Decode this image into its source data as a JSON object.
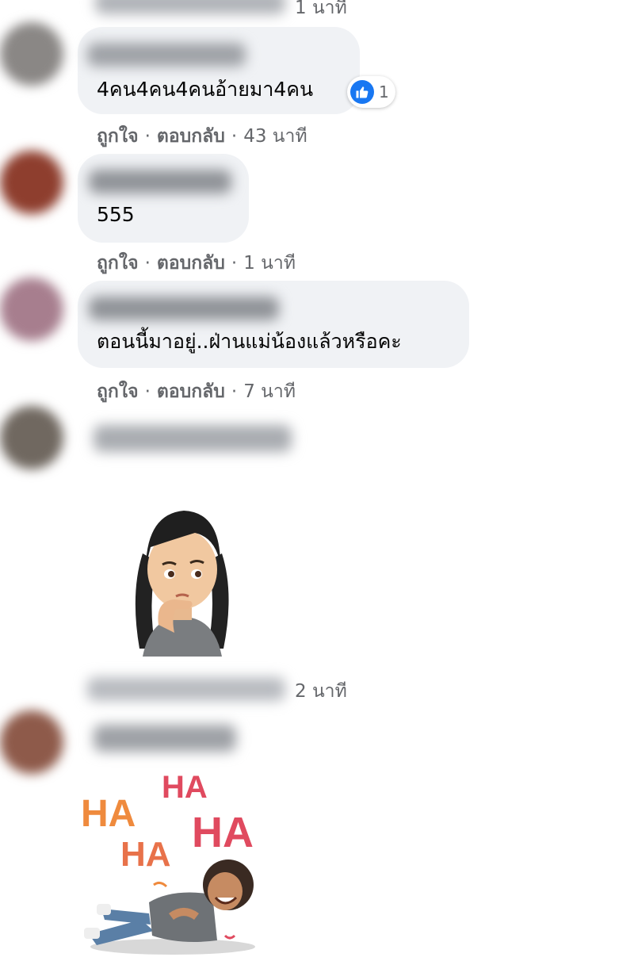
{
  "comments": [
    {
      "id": "c0",
      "time": "1 นาที"
    },
    {
      "id": "c1",
      "text": "4คน4คน4คนอ้ายมา4คน",
      "reaction_count": "1",
      "like_label": "ถูกใจ",
      "reply_label": "ตอบกลับ",
      "time": "43 นาที",
      "avatar_color": "#7d7a77"
    },
    {
      "id": "c2",
      "text": "555",
      "like_label": "ถูกใจ",
      "reply_label": "ตอบกลับ",
      "time": "1 นาที",
      "avatar_color": "#8a3b2b"
    },
    {
      "id": "c3",
      "text": "ตอนนี้มาอยู่..ฝ่านแม่น้องแล้วหรือคะ",
      "like_label": "ถูกใจ",
      "reply_label": "ตอบกลับ",
      "time": "7 นาที",
      "avatar_color": "#9a6e7a"
    },
    {
      "id": "c4",
      "sticker": "thinking-avatar-sticker",
      "time": "2 นาที",
      "avatar_color": "#6e6660"
    },
    {
      "id": "c5",
      "sticker": "haha-avatar-sticker",
      "sticker_text": [
        "HA",
        "HA",
        "HA",
        "HA"
      ],
      "avatar_color": "#8a5a4a"
    }
  ],
  "separator": "·",
  "colors": {
    "bubble": "#f0f2f5",
    "meta": "#65676b",
    "like_blue": "#1877f2"
  }
}
